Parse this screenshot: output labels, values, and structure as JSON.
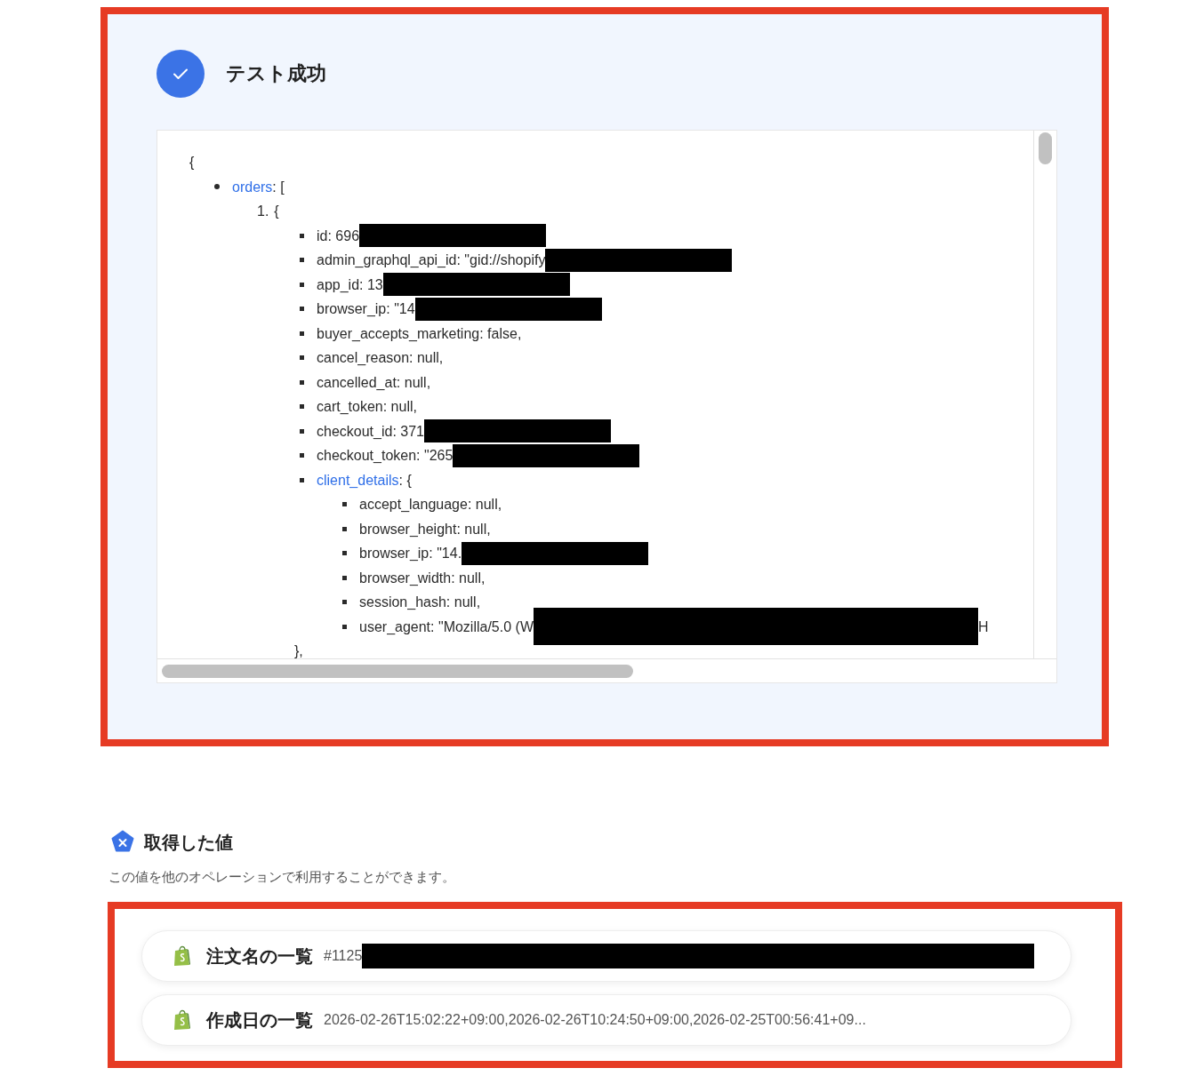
{
  "test_result": {
    "title": "テスト成功",
    "success": true,
    "json_view": {
      "open": "{",
      "lines": [
        {
          "key": "orders",
          "text": ": [",
          "children": [
            {
              "marker": "1.",
              "text": "{",
              "children": [
                {
                  "text": "id: 696",
                  "redacted": true
                },
                {
                  "text": "admin_graphql_api_id: \"gid://shopify",
                  "redacted": true
                },
                {
                  "text": "app_id: 13",
                  "redacted": true
                },
                {
                  "text": "browser_ip: \"14",
                  "redacted": true
                },
                {
                  "text": "buyer_accepts_marketing: false,"
                },
                {
                  "text": "cancel_reason: null,"
                },
                {
                  "text": "cancelled_at: null,"
                },
                {
                  "text": "cart_token: null,"
                },
                {
                  "text": "checkout_id: 371",
                  "redacted": true
                },
                {
                  "text": "checkout_token: \"265",
                  "redacted": true
                },
                {
                  "key": "client_details",
                  "text": ": {",
                  "children": [
                    {
                      "text": "accept_language: null,"
                    },
                    {
                      "text": "browser_height: null,"
                    },
                    {
                      "text": "browser_ip: \"14.",
                      "redacted": true
                    },
                    {
                      "text": "browser_width: null,"
                    },
                    {
                      "text": "session_hash: null,"
                    },
                    {
                      "text": "user_agent: \"Mozilla/5.0 (W",
                      "redacted": true,
                      "tail": "H"
                    }
                  ],
                  "close": "},"
                }
              ]
            }
          ]
        }
      ]
    }
  },
  "obtained_values": {
    "title": "取得した値",
    "description": "この値を他のオペレーションで利用することができます。",
    "rows": [
      {
        "label": "注文名の一覧",
        "value": "#1125",
        "redacted": true
      },
      {
        "label": "作成日の一覧",
        "value": "2026-02-26T15:02:22+09:00,2026-02-26T10:24:50+09:00,2026-02-25T00:56:41+09...",
        "redacted": false
      }
    ]
  }
}
